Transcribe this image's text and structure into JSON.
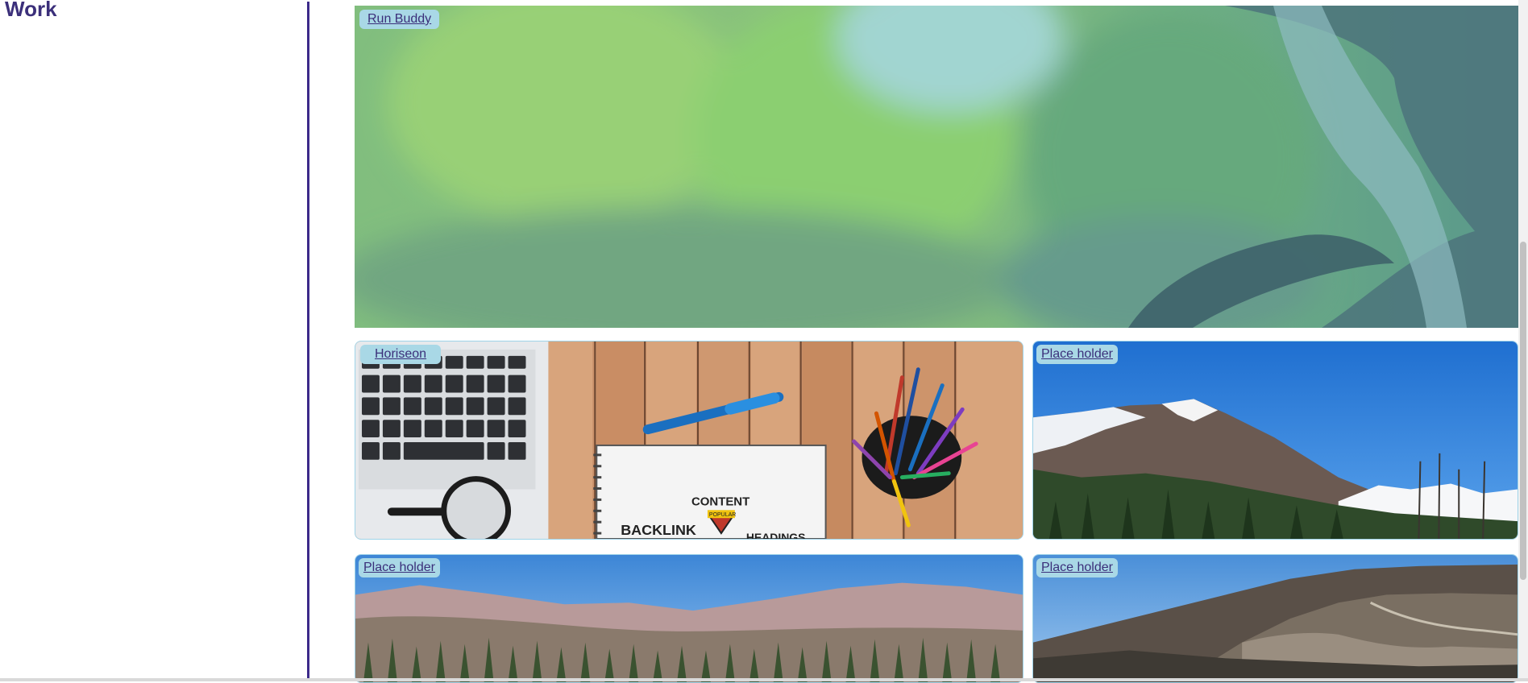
{
  "section": {
    "title": "Work"
  },
  "projects": [
    {
      "label": "Run Buddy"
    },
    {
      "label": "Horiseon"
    },
    {
      "label": "Place holder"
    },
    {
      "label": "Place holder"
    },
    {
      "label": "Place holder"
    }
  ],
  "horiseon_image_text": {
    "content": "CONTENT",
    "popular": "POPULAR",
    "backlink": "BACKLINK",
    "headings": "HEADINGS"
  },
  "colors": {
    "heading": "#3b2f7a",
    "divider": "#3c2a8a",
    "label_bg": "#a9d8e6",
    "card_border": "#9fd3e8"
  }
}
